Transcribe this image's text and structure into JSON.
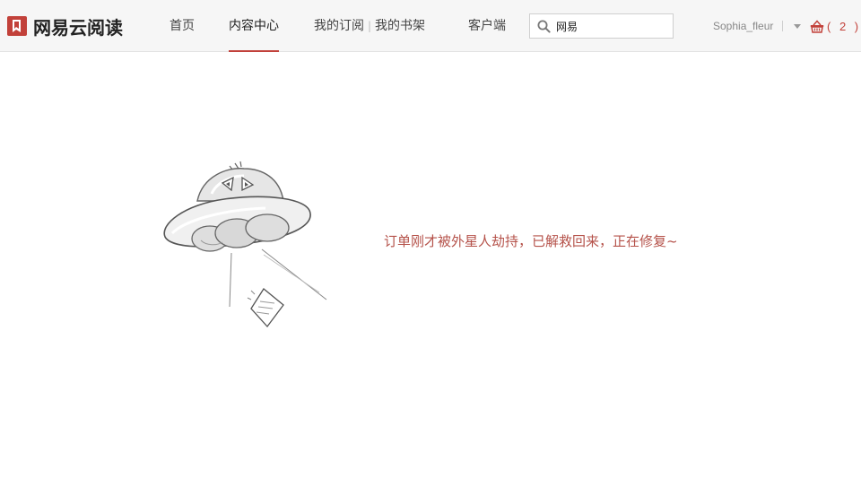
{
  "brand": {
    "name": "网易云阅读",
    "accent_color": "#c2413a",
    "logo_icon": "book-logo-icon"
  },
  "nav": {
    "home": "首页",
    "content_center": "内容中心",
    "my_subscriptions": "我的订阅",
    "separator": "|",
    "my_bookshelf": "我的书架",
    "client": "客户端",
    "active": "content_center"
  },
  "search": {
    "value": "网易",
    "icon": "search-icon"
  },
  "user": {
    "name": "Sophia_fleur",
    "menu_icon": "caret-down-icon"
  },
  "cart": {
    "icon": "basket-icon",
    "count_label": "( 2 )"
  },
  "main": {
    "illustration": "ufo-illustration",
    "message": "订单刚才被外星人劫持，已解救回来，正在修复~",
    "message_color": "#b5524a"
  }
}
